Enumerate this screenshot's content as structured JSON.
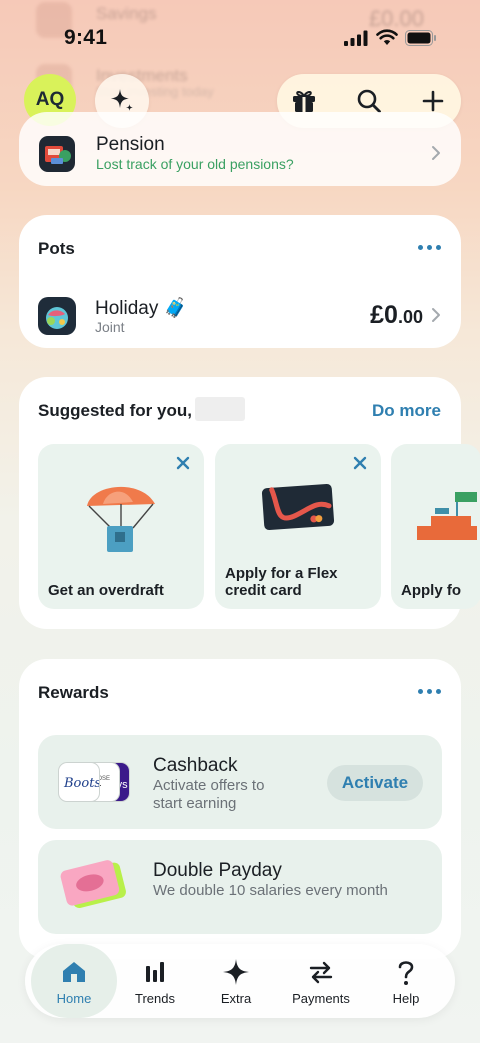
{
  "status_bar": {
    "time": "9:41"
  },
  "header": {
    "avatar_initials": "AQ"
  },
  "pension": {
    "title": "Pension",
    "subtitle": "Lost track of your old pensions?"
  },
  "pots": {
    "title": "Pots",
    "item": {
      "name": "Holiday",
      "emoji": "🧳",
      "subtitle": "Joint",
      "amount_main": "£0",
      "amount_pence": ".00"
    }
  },
  "suggested": {
    "title": "Suggested for you,",
    "action": "Do more",
    "tiles": [
      {
        "label": "Get an overdraft"
      },
      {
        "label": "Apply for a Flex credit card"
      },
      {
        "label": "Apply fo"
      }
    ]
  },
  "rewards": {
    "title": "Rewards",
    "items": [
      {
        "title": "Cashback",
        "subtitle": "Activate offers to start earning",
        "action": "Activate",
        "brand": "Boots"
      },
      {
        "title": "Double Payday",
        "subtitle": "We double 10 salaries every month"
      }
    ]
  },
  "tabs": [
    {
      "label": "Home",
      "icon": "home-icon",
      "active": true
    },
    {
      "label": "Trends",
      "icon": "trends-icon"
    },
    {
      "label": "Extra",
      "icon": "sparkle-icon"
    },
    {
      "label": "Payments",
      "icon": "transfer-icon"
    },
    {
      "label": "Help",
      "icon": "help-icon"
    }
  ],
  "colors": {
    "accent": "#2f7fb0",
    "green": "#3aa062",
    "avatar": "#d9f25a"
  }
}
